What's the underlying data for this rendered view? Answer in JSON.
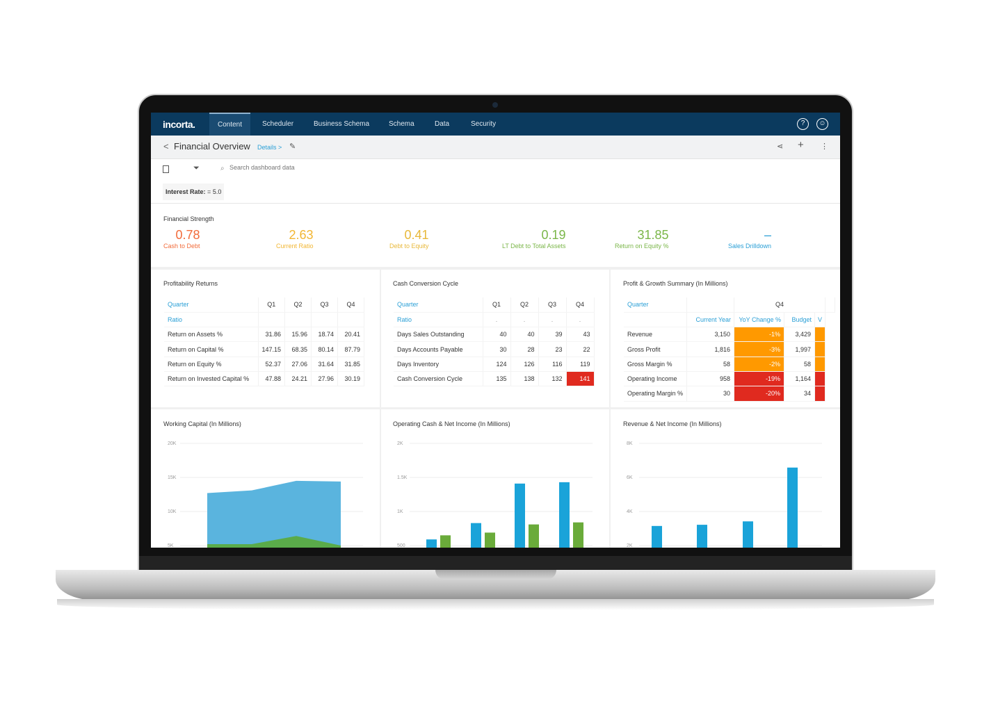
{
  "nav": {
    "logo": "incorta.",
    "tabs": [
      "Content",
      "Scheduler",
      "Business Schema",
      "Schema",
      "Data",
      "Security"
    ],
    "active": "Content",
    "icons": [
      "help-icon",
      "user-icon"
    ]
  },
  "header": {
    "back": "<",
    "title": "Financial Overview",
    "details": "Details >",
    "icons": [
      "pin-icon",
      "share-icon",
      "plus-icon",
      "more-icon"
    ]
  },
  "toolbar": {
    "search_placeholder": "Search dashboard data",
    "icons": [
      "bookmark-icon",
      "filter-icon",
      "search-icon"
    ]
  },
  "filter": {
    "label": "Interest Rate:",
    "op": "=",
    "value": "5.0"
  },
  "financial_strength": {
    "title": "Financial Strength",
    "kpis": [
      {
        "value": "0.78",
        "label": "Cash to Debt",
        "color": "#f26b3a"
      },
      {
        "value": "2.63",
        "label": "Current Ratio",
        "color": "#f2b632"
      },
      {
        "value": "0.41",
        "label": "Debt to Equity",
        "color": "#e8b83a"
      },
      {
        "value": "0.19",
        "label": "LT Debt to Total Assets",
        "color": "#7ab648"
      },
      {
        "value": "31.85",
        "label": "Return on Equity %",
        "color": "#7ab648"
      },
      {
        "value": "–",
        "label": "Sales Drilldown",
        "color": "#2a9fd6"
      }
    ]
  },
  "profitability": {
    "title": "Profitability Returns",
    "col_header": "Quarter",
    "row_header": "Ratio",
    "quarters": [
      "Q1",
      "Q2",
      "Q3",
      "Q4"
    ],
    "rows": [
      [
        "Return on Assets %",
        "31.86",
        "15.96",
        "18.74",
        "20.41"
      ],
      [
        "Return on Capital %",
        "147.15",
        "68.35",
        "80.14",
        "87.79"
      ],
      [
        "Return on Equity %",
        "52.37",
        "27.06",
        "31.64",
        "31.85"
      ],
      [
        "Return on Invested Capital %",
        "47.88",
        "24.21",
        "27.96",
        "30.19"
      ]
    ]
  },
  "cash_cycle": {
    "title": "Cash Conversion Cycle",
    "col_header": "Quarter",
    "row_header": "Ratio",
    "quarters": [
      "Q1",
      "Q2",
      "Q3",
      "Q4"
    ],
    "ratio_row": [
      ".",
      ".",
      ".",
      "."
    ],
    "rows": [
      [
        "Days Sales Outstanding",
        "40",
        "40",
        "39",
        "43"
      ],
      [
        "Days Accounts Payable",
        "30",
        "28",
        "23",
        "22"
      ],
      [
        "Days Inventory",
        "124",
        "126",
        "116",
        "119"
      ],
      [
        "Cash Conversion Cycle",
        "135",
        "138",
        "132",
        "141"
      ]
    ],
    "highlight_color": "#e02a1f"
  },
  "profit_growth": {
    "title": "Profit & Growth Summary (In Millions)",
    "col_header": "Quarter",
    "quarter": "Q4",
    "subcols": [
      "Current Year",
      "YoY Change %",
      "Budget",
      "V"
    ],
    "rows": [
      [
        "Revenue",
        "3,150",
        "-1%",
        "3,429",
        "#ff9900"
      ],
      [
        "Gross Profit",
        "1,816",
        "-3%",
        "1,997",
        "#ff9900"
      ],
      [
        "Gross Margin %",
        "58",
        "-2%",
        "58",
        "#ff9900"
      ],
      [
        "Operating Income",
        "958",
        "-19%",
        "1,164",
        "#e02a1f"
      ],
      [
        "Operating Margin %",
        "30",
        "-20%",
        "34",
        "#e02a1f"
      ]
    ]
  },
  "chart_data": [
    {
      "type": "area",
      "title": "Working Capital (In Millions)",
      "yticks": [
        "20K",
        "15K",
        "10K",
        "5K"
      ],
      "ylim": [
        5000,
        20000
      ],
      "grid": true,
      "series": [
        {
          "color": "#5ab4de",
          "values": [
            12700,
            13100,
            14500,
            14400
          ]
        },
        {
          "color": "#5aab4a",
          "values": [
            5200,
            5200,
            6400,
            5000
          ]
        }
      ]
    },
    {
      "type": "bar",
      "title": "Operating Cash & Net Income (In Millions)",
      "yticks": [
        "2K",
        "1.5K",
        "1K",
        "500"
      ],
      "ylim": [
        500,
        2000
      ],
      "grid": true,
      "series": [
        {
          "color": "#1aa3d9",
          "values": [
            590,
            830,
            1410,
            1430
          ]
        },
        {
          "color": "#6aab3a",
          "values": [
            650,
            690,
            810,
            840
          ]
        }
      ]
    },
    {
      "type": "bar",
      "title": "Revenue & Net Income (In Millions)",
      "yticks": [
        "8K",
        "6K",
        "4K",
        "2K"
      ],
      "ylim": [
        2000,
        8000
      ],
      "grid": true,
      "series": [
        {
          "color": "#1aa3d9",
          "values": [
            3150,
            3220,
            3420,
            6580
          ]
        }
      ]
    }
  ]
}
